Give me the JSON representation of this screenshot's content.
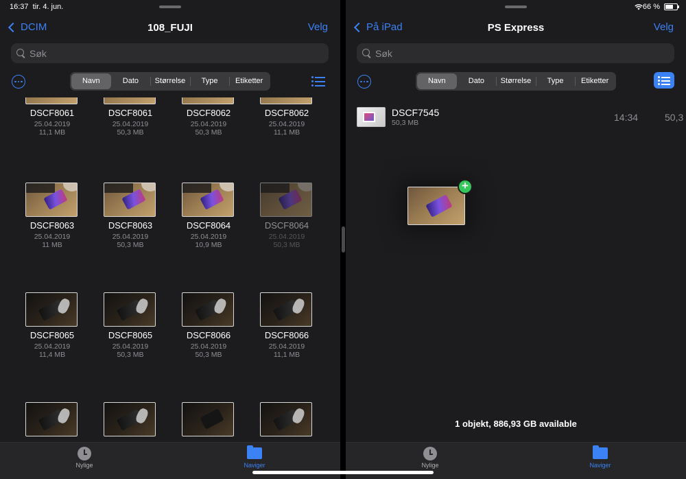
{
  "status": {
    "time": "16:37",
    "date": "tir. 4. jun.",
    "battery": "66 %"
  },
  "left": {
    "back_label": "DCIM",
    "title": "108_FUJI",
    "select_label": "Velg",
    "search_placeholder": "Søk",
    "sort_tabs": [
      "Navn",
      "Dato",
      "Størrelse",
      "Type",
      "Etiketter"
    ],
    "active_sort": "Navn",
    "files": [
      {
        "name": "DSCF8061",
        "date": "25.04.2019",
        "size": "11,1 MB",
        "thumb": "partial"
      },
      {
        "name": "DSCF8061",
        "date": "25.04.2019",
        "size": "50,3 MB",
        "thumb": "partial"
      },
      {
        "name": "DSCF8062",
        "date": "25.04.2019",
        "size": "50,3 MB",
        "thumb": "partial"
      },
      {
        "name": "DSCF8062",
        "date": "25.04.2019",
        "size": "11,1 MB",
        "thumb": "partial"
      },
      {
        "name": "DSCF8063",
        "date": "25.04.2019",
        "size": "11 MB",
        "thumb": "phone"
      },
      {
        "name": "DSCF8063",
        "date": "25.04.2019",
        "size": "50,3 MB",
        "thumb": "phone"
      },
      {
        "name": "DSCF8064",
        "date": "25.04.2019",
        "size": "10,9 MB",
        "thumb": "phone"
      },
      {
        "name": "DSCF8064",
        "date": "25.04.2019",
        "size": "50,3 MB",
        "thumb": "phone",
        "dimmed": true
      },
      {
        "name": "DSCF8065",
        "date": "25.04.2019",
        "size": "11,4 MB",
        "thumb": "black"
      },
      {
        "name": "DSCF8065",
        "date": "25.04.2019",
        "size": "50,3 MB",
        "thumb": "black"
      },
      {
        "name": "DSCF8066",
        "date": "25.04.2019",
        "size": "50,3 MB",
        "thumb": "black"
      },
      {
        "name": "DSCF8066",
        "date": "25.04.2019",
        "size": "11,1 MB",
        "thumb": "black"
      },
      {
        "name": "",
        "date": "",
        "size": "",
        "thumb": "black"
      },
      {
        "name": "",
        "date": "",
        "size": "",
        "thumb": "black"
      },
      {
        "name": "",
        "date": "",
        "size": "",
        "thumb": "dark"
      },
      {
        "name": "",
        "date": "",
        "size": "",
        "thumb": "black"
      }
    ],
    "tabs": {
      "recent": "Nylige",
      "browse": "Naviger"
    }
  },
  "right": {
    "back_label": "På iPad",
    "title": "PS Express",
    "select_label": "Velg",
    "search_placeholder": "Søk",
    "sort_tabs": [
      "Navn",
      "Dato",
      "Størrelse",
      "Type",
      "Etiketter"
    ],
    "active_sort": "Navn",
    "file": {
      "name": "DSCF7545",
      "size": "50,3 MB",
      "time": "14:34",
      "size_col": "50,3"
    },
    "footer": "1 objekt, 886,93 GB available",
    "tabs": {
      "recent": "Nylige",
      "browse": "Naviger"
    }
  },
  "colors": {
    "accent": "#3b82f6",
    "background": "#1c1c1e",
    "add_badge": "#34c759"
  }
}
